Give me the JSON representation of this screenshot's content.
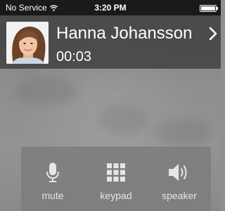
{
  "status_bar": {
    "carrier": "No Service",
    "time": "3:20 PM",
    "battery_level": 1.0
  },
  "call": {
    "caller_name": "Hanna Johansson",
    "duration": "00:03"
  },
  "controls": [
    {
      "label": "mute",
      "icon": "microphone-icon"
    },
    {
      "label": "keypad",
      "icon": "keypad-icon"
    },
    {
      "label": "speaker",
      "icon": "speaker-icon"
    }
  ],
  "colors": {
    "header_bg": "#464646",
    "status_bg": "#1a1a1a",
    "panel_bg": "#7d7d7d",
    "text": "#ffffff"
  }
}
